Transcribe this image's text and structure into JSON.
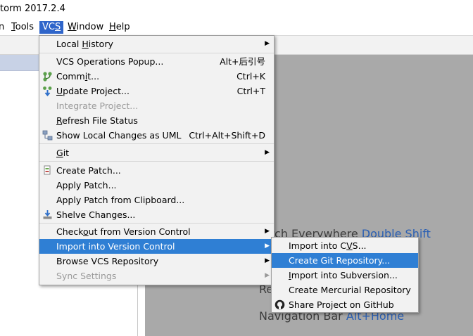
{
  "title": "torm 2017.2.4",
  "menubar": [
    {
      "label": "n"
    },
    {
      "label": "Tools"
    },
    {
      "label": "VCS"
    },
    {
      "label": "Window"
    },
    {
      "label": "Help"
    }
  ],
  "editor_hints": {
    "search_text": "arch Everywhere ",
    "search_key": "Double Shift",
    "recent_text": "Re",
    "nav_text": "Navigation Bar ",
    "nav_key": "Alt+Home"
  },
  "vcs_menu": {
    "local_history": "Local History",
    "ops_popup": "VCS Operations Popup...",
    "ops_popup_sc": "Alt+后引号",
    "commit": "Commit...",
    "commit_sc": "Ctrl+K",
    "update": "Update Project...",
    "update_sc": "Ctrl+T",
    "integrate": "Integrate Project...",
    "refresh": "Refresh File Status",
    "show_uml": "Show Local Changes as UML",
    "show_uml_sc": "Ctrl+Alt+Shift+D",
    "git": "Git",
    "create_patch": "Create Patch...",
    "apply_patch": "Apply Patch...",
    "apply_clip": "Apply Patch from Clipboard...",
    "shelve": "Shelve Changes...",
    "checkout": "Checkout from Version Control",
    "import": "Import into Version Control",
    "browse": "Browse VCS Repository",
    "sync": "Sync Settings"
  },
  "import_submenu": {
    "cvs": "Import into CVS...",
    "git": "Create Git Repository...",
    "svn": "Import into Subversion...",
    "hg": "Create Mercurial Repository",
    "github": "Share Project on GitHub"
  }
}
